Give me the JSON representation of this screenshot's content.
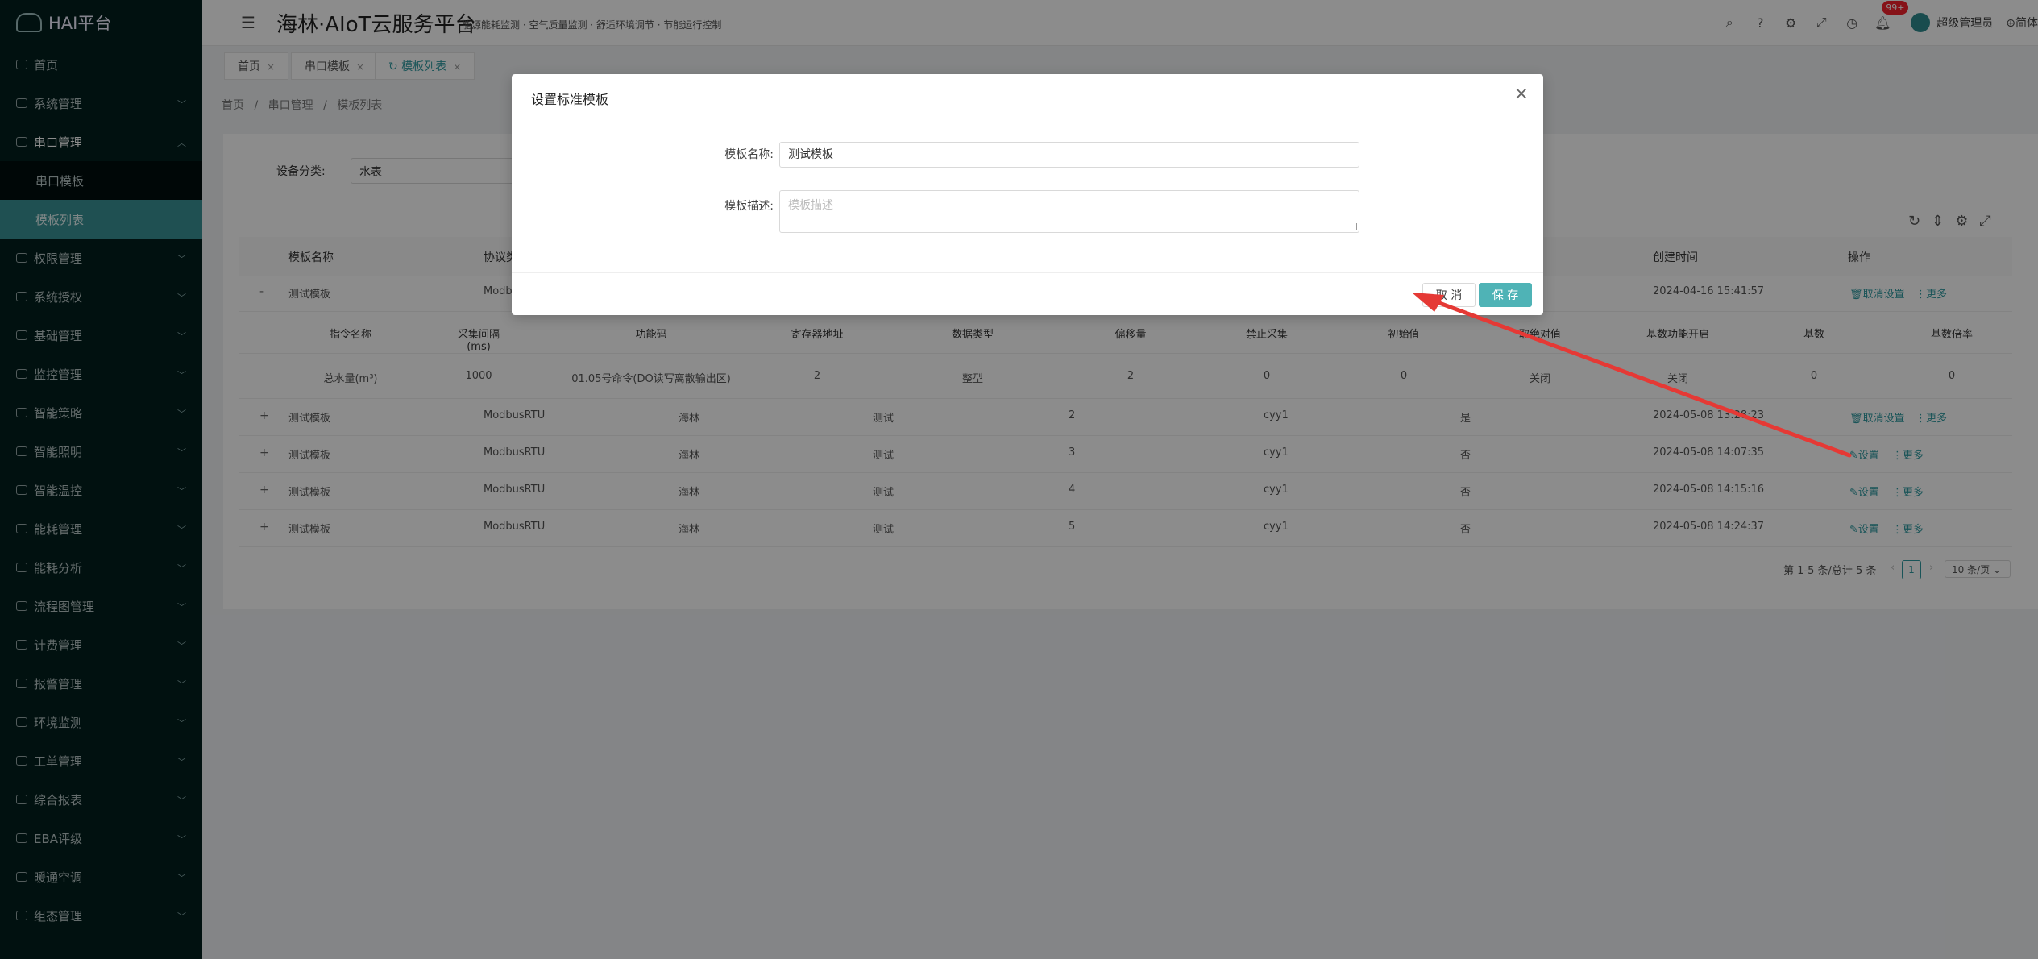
{
  "app": {
    "logo": "HAI平台",
    "title": "海林·AIoT云服务平台",
    "subtitle": "能源能耗监测 · 空气质量监测 · 舒适环境调节 · 节能运行控制"
  },
  "header": {
    "badge": "99+",
    "user": "超级管理员",
    "lang": "简体"
  },
  "sidebar": {
    "items": [
      {
        "label": "首页"
      },
      {
        "label": "系统管理"
      },
      {
        "label": "串口管理"
      },
      {
        "label": "权限管理"
      },
      {
        "label": "系统授权"
      },
      {
        "label": "基础管理"
      },
      {
        "label": "监控管理"
      },
      {
        "label": "智能策略"
      },
      {
        "label": "智能照明"
      },
      {
        "label": "智能温控"
      },
      {
        "label": "能耗管理"
      },
      {
        "label": "能耗分析"
      },
      {
        "label": "流程图管理"
      },
      {
        "label": "计费管理"
      },
      {
        "label": "报警管理"
      },
      {
        "label": "环境监测"
      },
      {
        "label": "工单管理"
      },
      {
        "label": "综合报表"
      },
      {
        "label": "EBA评级"
      },
      {
        "label": "暖通空调"
      },
      {
        "label": "组态管理"
      }
    ],
    "sub": [
      "串口模板",
      "模板列表"
    ]
  },
  "tabs": [
    {
      "label": "首页"
    },
    {
      "label": "串口模板"
    },
    {
      "label": "模板列表"
    }
  ],
  "breadcrumb": {
    "a": "首页",
    "b": "串口管理",
    "c": "模板列表",
    "sep": "/"
  },
  "filter": {
    "label": "设备分类:",
    "value": "水表"
  },
  "table": {
    "headers": [
      "模板名称",
      "协议类",
      "创建时间",
      "操作"
    ],
    "sub_headers": [
      "指令名称",
      "采集间隔(ms)",
      "功能码",
      "寄存器地址",
      "数据类型",
      "偏移量",
      "禁止采集",
      "初始值",
      "取绝对值",
      "基数功能开启",
      "基数",
      "基数倍率"
    ],
    "sub_row": [
      "总水量(m³)",
      "1000",
      "01.05号命令(DO读写离散输出区)",
      "2",
      "整型",
      "2",
      "0",
      "0",
      "关闭",
      "关闭",
      "0",
      "0"
    ],
    "row0": {
      "expander": "-",
      "name": "测试模板",
      "proto": "Modbu",
      "time": "2024-04-16 15:41:57",
      "op1": "取消设置",
      "op2": "更多"
    },
    "rows": [
      {
        "expander": "+",
        "name": "测试模板",
        "proto": "ModbusRTU",
        "brand": "海林",
        "desc": "测试",
        "num": "2",
        "user": "cyy1",
        "flag": "是",
        "time": "2024-05-08 13:28:23",
        "op1": "取消设置",
        "op2": "更多"
      },
      {
        "expander": "+",
        "name": "测试模板",
        "proto": "ModbusRTU",
        "brand": "海林",
        "desc": "测试",
        "num": "3",
        "user": "cyy1",
        "flag": "否",
        "time": "2024-05-08 14:07:35",
        "op1": "设置",
        "op2": "更多"
      },
      {
        "expander": "+",
        "name": "测试模板",
        "proto": "ModbusRTU",
        "brand": "海林",
        "desc": "测试",
        "num": "4",
        "user": "cyy1",
        "flag": "否",
        "time": "2024-05-08 14:15:16",
        "op1": "设置",
        "op2": "更多"
      },
      {
        "expander": "+",
        "name": "测试模板",
        "proto": "ModbusRTU",
        "brand": "海林",
        "desc": "测试",
        "num": "5",
        "user": "cyy1",
        "flag": "否",
        "time": "2024-05-08 14:24:37",
        "op1": "设置",
        "op2": "更多"
      }
    ]
  },
  "pagination": {
    "total": "第 1-5 条/总计 5 条",
    "page": "1",
    "size": "10 条/页"
  },
  "modal": {
    "title": "设置标准模板",
    "name_label": "模板名称:",
    "name_value": "测试模板",
    "desc_label": "模板描述:",
    "desc_placeholder": "模板描述",
    "cancel": "取 消",
    "save": "保 存"
  },
  "colors": {
    "accent": "#4fb3b6",
    "sidebar": "#031f1e",
    "arrow": "#e53935"
  }
}
